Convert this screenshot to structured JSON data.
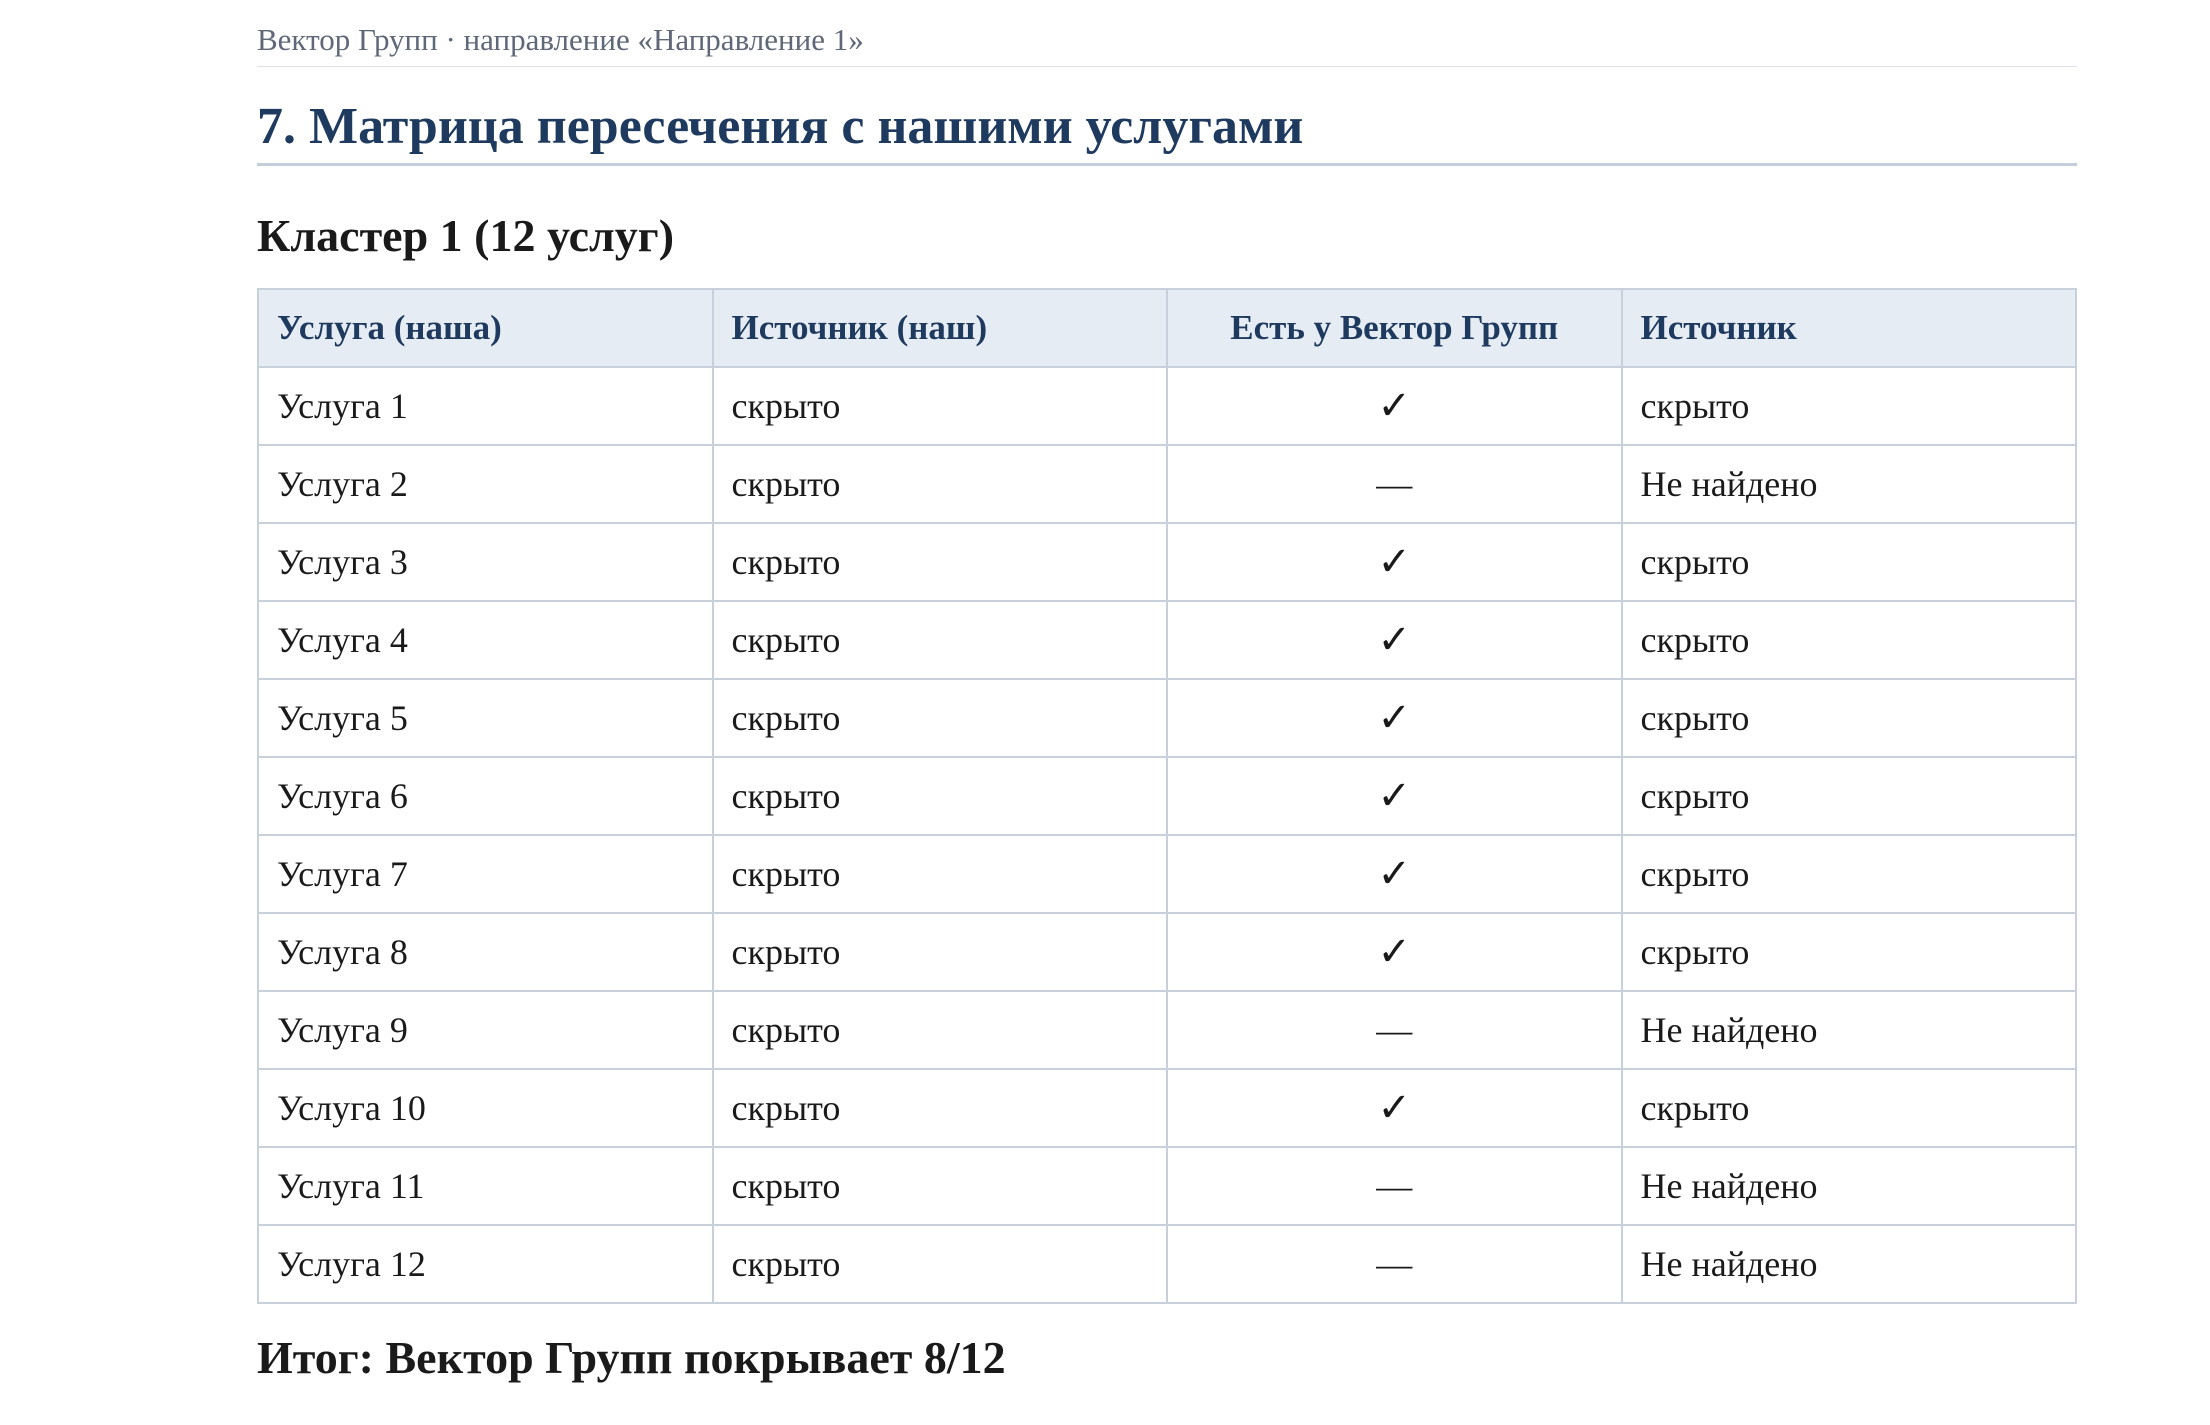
{
  "breadcrumb": "Вектор Групп · направление «Направление 1»",
  "section_title": "7. Матрица пересечения с нашими услугами",
  "cluster_title": "Кластер 1 (12 услуг)",
  "table": {
    "headers": [
      "Услуга (наша)",
      "Источник (наш)",
      "Есть у Вектор Групп",
      "Источник"
    ],
    "rows": [
      {
        "service": "Услуга 1",
        "our_source": "скрыто",
        "present": "✓",
        "source": "скрыто"
      },
      {
        "service": "Услуга 2",
        "our_source": "скрыто",
        "present": "—",
        "source": "Не найдено"
      },
      {
        "service": "Услуга 3",
        "our_source": "скрыто",
        "present": "✓",
        "source": "скрыто"
      },
      {
        "service": "Услуга 4",
        "our_source": "скрыто",
        "present": "✓",
        "source": "скрыто"
      },
      {
        "service": "Услуга 5",
        "our_source": "скрыто",
        "present": "✓",
        "source": "скрыто"
      },
      {
        "service": "Услуга 6",
        "our_source": "скрыто",
        "present": "✓",
        "source": "скрыто"
      },
      {
        "service": "Услуга 7",
        "our_source": "скрыто",
        "present": "✓",
        "source": "скрыто"
      },
      {
        "service": "Услуга 8",
        "our_source": "скрыто",
        "present": "✓",
        "source": "скрыто"
      },
      {
        "service": "Услуга 9",
        "our_source": "скрыто",
        "present": "—",
        "source": "Не найдено"
      },
      {
        "service": "Услуга 10",
        "our_source": "скрыто",
        "present": "✓",
        "source": "скрыто"
      },
      {
        "service": "Услуга 11",
        "our_source": "скрыто",
        "present": "—",
        "source": "Не найдено"
      },
      {
        "service": "Услуга 12",
        "our_source": "скрыто",
        "present": "—",
        "source": "Не найдено"
      }
    ]
  },
  "summary": "Итог: Вектор Групп покрывает 8/12",
  "colors": {
    "heading": "#1f3a5f",
    "header_bg": "#e6ecf4",
    "border": "#c8d0dc",
    "muted": "#5e6878"
  }
}
